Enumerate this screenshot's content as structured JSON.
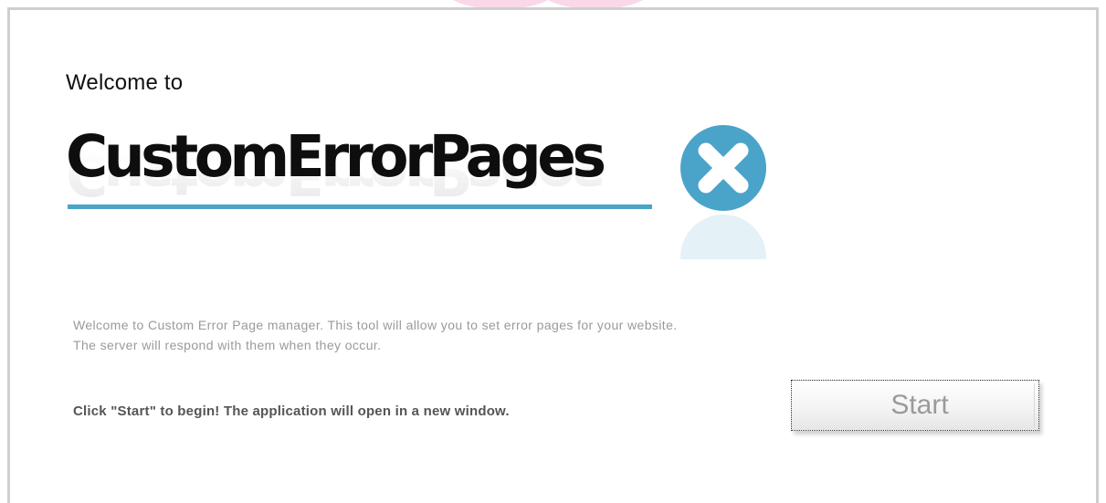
{
  "welcome": {
    "heading": "Welcome to"
  },
  "logo": {
    "text": "CustomErrorPages",
    "badge_icon": "close-x-icon",
    "badge_color": "#4aa3c9",
    "underline_color": "#4aa3c9"
  },
  "description": {
    "text": "Welcome to Custom Error Page manager. This tool will allow you to set error pages for your website. The server will respond with them when they occur."
  },
  "cta": {
    "text": "Click \"Start\" to begin! The application will open in a new window."
  },
  "start_button": {
    "label": "Start"
  }
}
